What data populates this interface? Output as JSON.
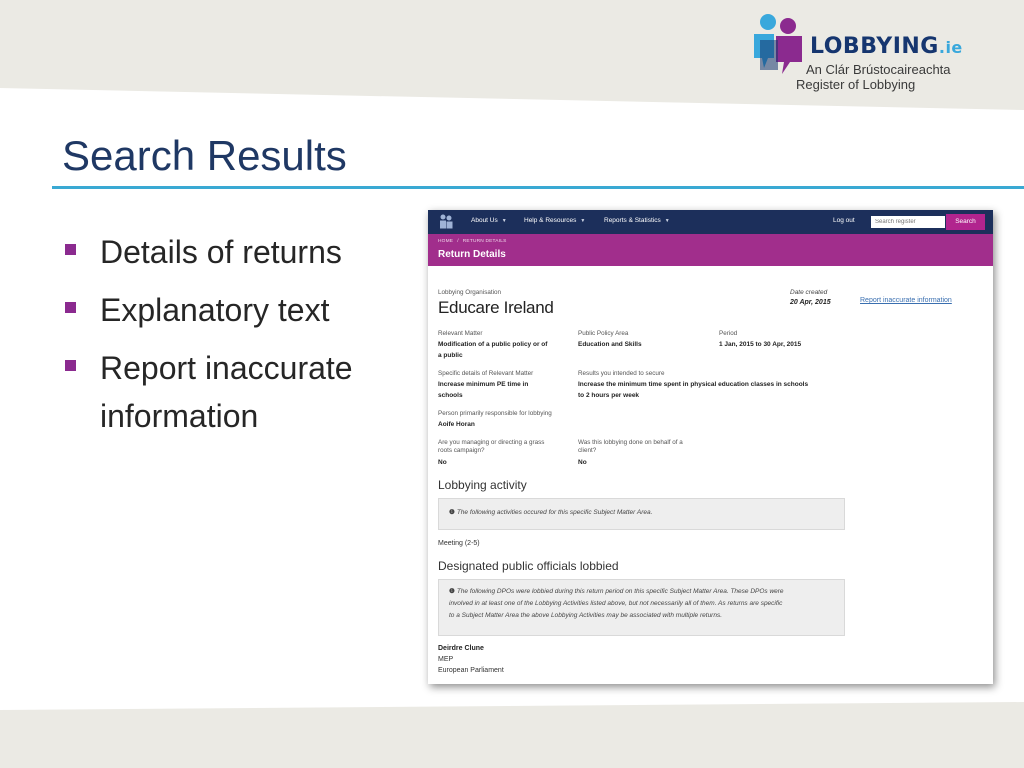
{
  "logo": {
    "word": "LOBBYING",
    "suffix": ".ie",
    "irish": "An Clár Brústocaireachta",
    "english": "Register of Lobbying",
    "colors": {
      "dark_blue": "#16366f",
      "light_blue": "#39a8dc",
      "purple": "#8b2a8f"
    }
  },
  "slide": {
    "title": "Search Results",
    "bullets": [
      "Details of returns",
      "Explanatory text",
      "Report inaccurate information"
    ]
  },
  "site": {
    "nav": {
      "items": [
        "About Us",
        "Help & Resources",
        "Reports & Statistics"
      ],
      "logout": "Log out",
      "search_placeholder": "Search register",
      "search_button": "Search"
    },
    "breadcrumb": [
      "HOME",
      "RETURN DETAILS"
    ],
    "page_title": "Return Details",
    "return": {
      "org_label": "Lobbying Organisation",
      "org_name": "Educare Ireland",
      "date_created_label": "Date created",
      "date_created": "20 Apr, 2015",
      "report_link": "Report inaccurate information",
      "relevant_matter_label": "Relevant Matter",
      "relevant_matter_line1": "Modification of a public policy or of",
      "relevant_matter_line2": "a public",
      "policy_area_label": "Public Policy Area",
      "policy_area": "Education and Skills",
      "period_label": "Period",
      "period": "1 Jan, 2015 to 30 Apr, 2015",
      "specific_details_label": "Specific details of Relevant Matter",
      "specific_details_line1": "Increase minimum PE time in",
      "specific_details_line2": "schools",
      "results_label": "Results you intended to secure",
      "results_line1": "Increase the minimum time spent in physical education classes in schools",
      "results_line2": "to 2 hours per week",
      "person_label": "Person primarily responsible for lobbying",
      "person": "Aoife Horan",
      "grassroots_label_line1": "Are you managing or directing a grass",
      "grassroots_label_line2": "roots campaign?",
      "grassroots": "No",
      "client_label_line1": "Was this lobbying done on behalf of a",
      "client_label_line2": "client?",
      "client": "No"
    },
    "activity": {
      "heading": "Lobbying activity",
      "note": "The following activities occured for this specific Subject Matter Area.",
      "meeting": "Meeting (2-5)"
    },
    "officials": {
      "heading": "Designated public officials lobbied",
      "note_line1": "The following DPOs were lobbied during this return period on this specific Subject Matter Area. These DPOs were",
      "note_line2": "involved in at least one of the Lobbying Activities listed above, but not necessarily all of them. As returns are specific",
      "note_line3": "to a Subject Matter Area the above Lobbying Activities may be associated with multiple returns.",
      "name": "Deirdre Clune",
      "title": "MEP",
      "body": "European Parliament"
    },
    "colors": {
      "nav_bg": "#1c2f5b",
      "band_bg": "#a12e8c",
      "button": "#b1248e",
      "link": "#3a6fb0"
    }
  }
}
